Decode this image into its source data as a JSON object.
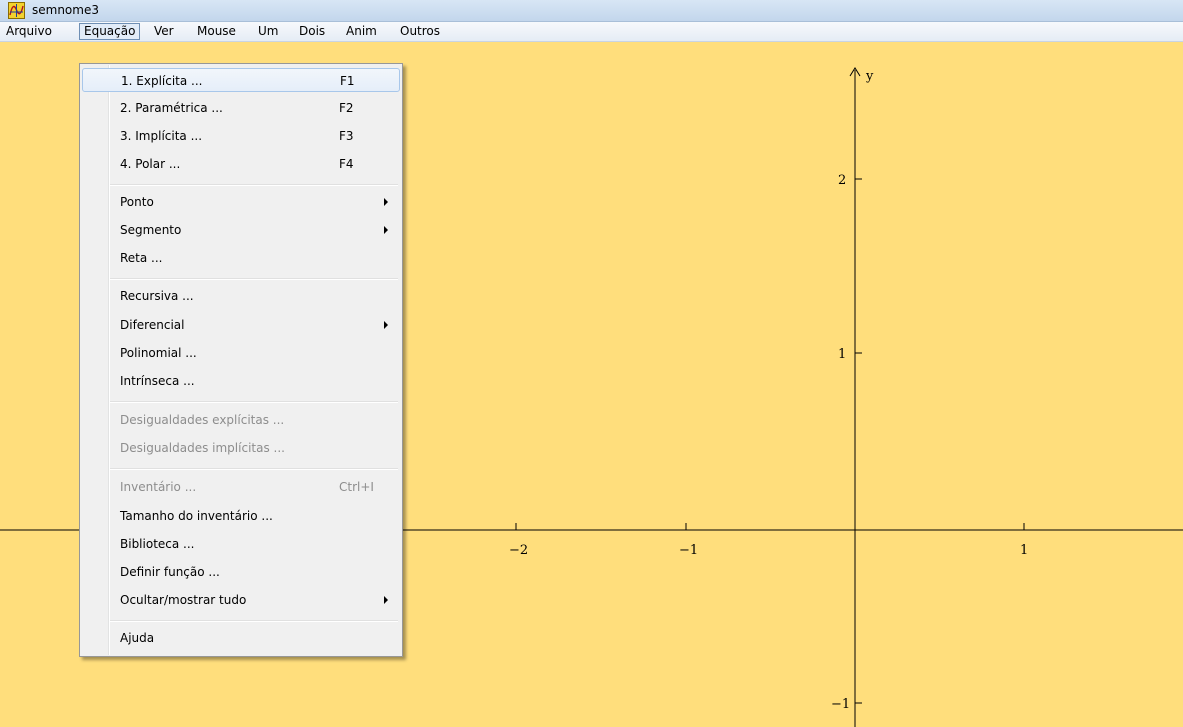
{
  "window": {
    "title": "semnome3",
    "icon": "graph-app-icon"
  },
  "menubar": {
    "items": [
      {
        "label": "Arquivo"
      },
      {
        "label": "Equação",
        "active": true
      },
      {
        "label": "Ver"
      },
      {
        "label": "Mouse"
      },
      {
        "label": "Um"
      },
      {
        "label": "Dois"
      },
      {
        "label": "Anim"
      },
      {
        "label": "Outros"
      }
    ]
  },
  "equation_menu": {
    "items": [
      {
        "label": "1. Explícita ...",
        "shortcut": "F1",
        "highlighted": true
      },
      {
        "label": "2. Paramétrica ...",
        "shortcut": "F2"
      },
      {
        "label": "3. Implícita ...",
        "shortcut": "F3"
      },
      {
        "label": "4. Polar ...",
        "shortcut": "F4"
      },
      {
        "label": "Ponto",
        "submenu": true
      },
      {
        "label": "Segmento",
        "submenu": true
      },
      {
        "label": "Reta ..."
      },
      {
        "label": "Recursiva ..."
      },
      {
        "label": "Diferencial",
        "submenu": true
      },
      {
        "label": "Polinomial ..."
      },
      {
        "label": "Intrínseca ..."
      },
      {
        "label": "Desigualdades explícitas ...",
        "disabled": true
      },
      {
        "label": "Desigualdades implícitas ...",
        "disabled": true
      },
      {
        "label": "Inventário ...",
        "shortcut": "Ctrl+I",
        "disabled": true
      },
      {
        "label": "Tamanho do inventário ..."
      },
      {
        "label": "Biblioteca ..."
      },
      {
        "label": "Definir função ..."
      },
      {
        "label": "Ocultar/mostrar tudo",
        "submenu": true
      },
      {
        "label": "Ajuda"
      }
    ]
  },
  "graph": {
    "background": "#ffde7c",
    "y_axis_label": "y",
    "x_ticks": [
      {
        "value": -2,
        "label": "−2"
      },
      {
        "value": -1,
        "label": "−1"
      },
      {
        "value": 1,
        "label": "1"
      }
    ],
    "y_ticks": [
      {
        "value": 2,
        "label": "2"
      },
      {
        "value": 1,
        "label": "1"
      },
      {
        "value": -1,
        "label": "−1"
      }
    ]
  }
}
